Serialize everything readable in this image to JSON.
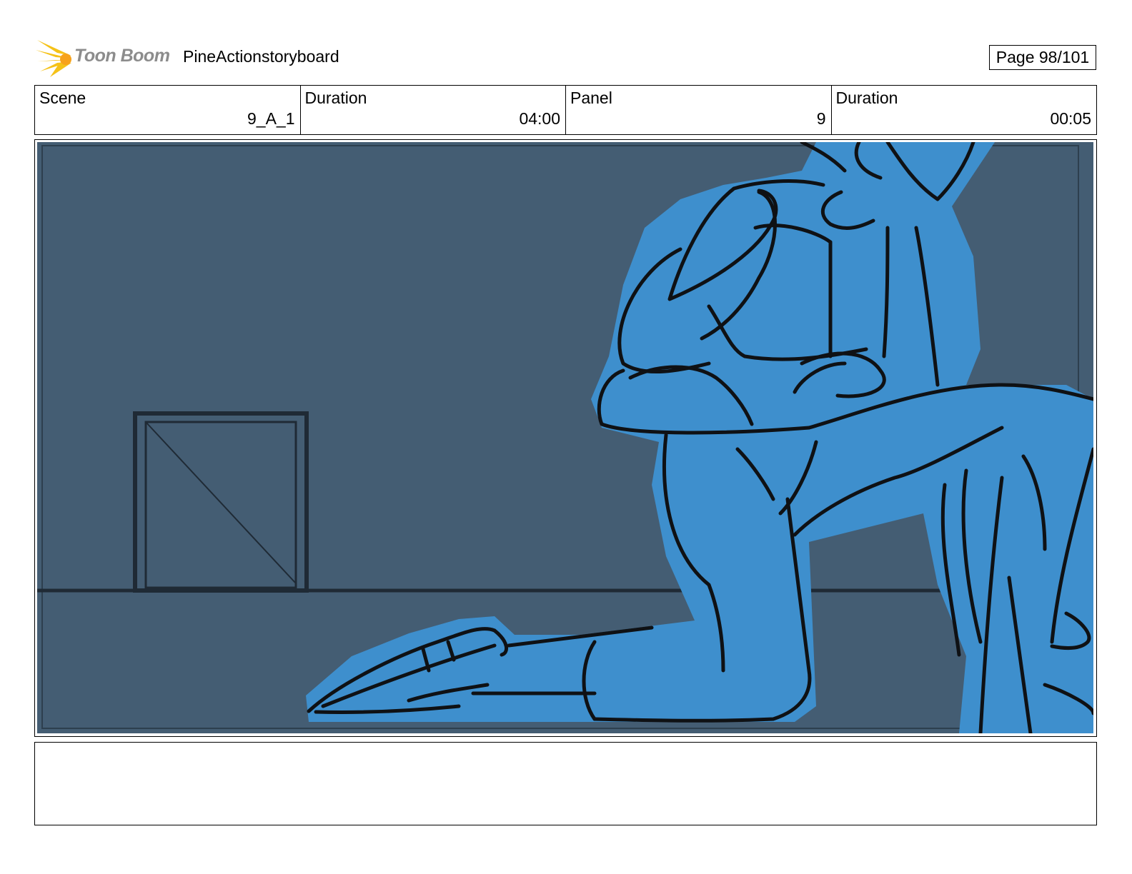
{
  "header": {
    "logo_text": "Toon Boom",
    "logo_icon": "starburst-logo-icon",
    "project_title": "PineActionstoryboard",
    "page_label": "Page  98/101"
  },
  "info": {
    "scene_label": "Scene",
    "scene_value": "9_A_1",
    "scene_duration_label": "Duration",
    "scene_duration_value": "04:00",
    "panel_label": "Panel",
    "panel_value": "9",
    "panel_duration_label": "Duration",
    "panel_duration_value": "00:05"
  },
  "panel": {
    "image": "storyboard-sketch-kneeling-figure",
    "colors": {
      "background": "#445d73",
      "figure_fill": "#3e8fcd",
      "line": "#0f1114",
      "set_line": "#1f2a35"
    }
  },
  "notes": {
    "text": ""
  }
}
